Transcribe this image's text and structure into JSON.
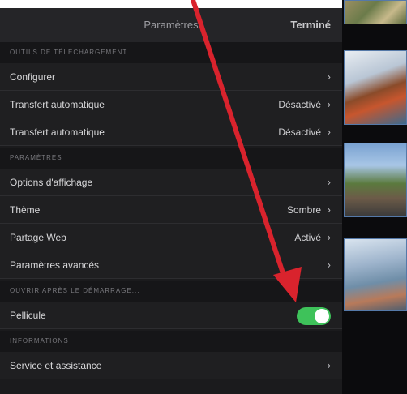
{
  "navbar": {
    "title": "Paramètres",
    "done_label": "Terminé"
  },
  "sections": {
    "transfer": {
      "header": "Outils de téléchargement"
    },
    "settings": {
      "header": "Paramètres"
    },
    "startup": {
      "header": "Ouvrir après le démarrage..."
    },
    "info": {
      "header": "Informations"
    }
  },
  "rows": {
    "configure": {
      "label": "Configurer"
    },
    "auto_transfer_1": {
      "label": "Transfert automatique",
      "value": "Désactivé"
    },
    "auto_transfer_2": {
      "label": "Transfert automatique",
      "value": "Désactivé"
    },
    "display_options": {
      "label": "Options d'affichage"
    },
    "theme": {
      "label": "Thème",
      "value": "Sombre"
    },
    "web_sharing": {
      "label": "Partage Web",
      "value": "Activé"
    },
    "advanced": {
      "label": "Paramètres avancés"
    },
    "camera_roll": {
      "label": "Pellicule",
      "enabled": true
    },
    "support": {
      "label": "Service et assistance"
    }
  },
  "colors": {
    "toggle_on": "#3ec25a",
    "arrow": "#d9232d",
    "thumb_border": "#5579a8"
  },
  "icons": {
    "chevron": "›"
  }
}
